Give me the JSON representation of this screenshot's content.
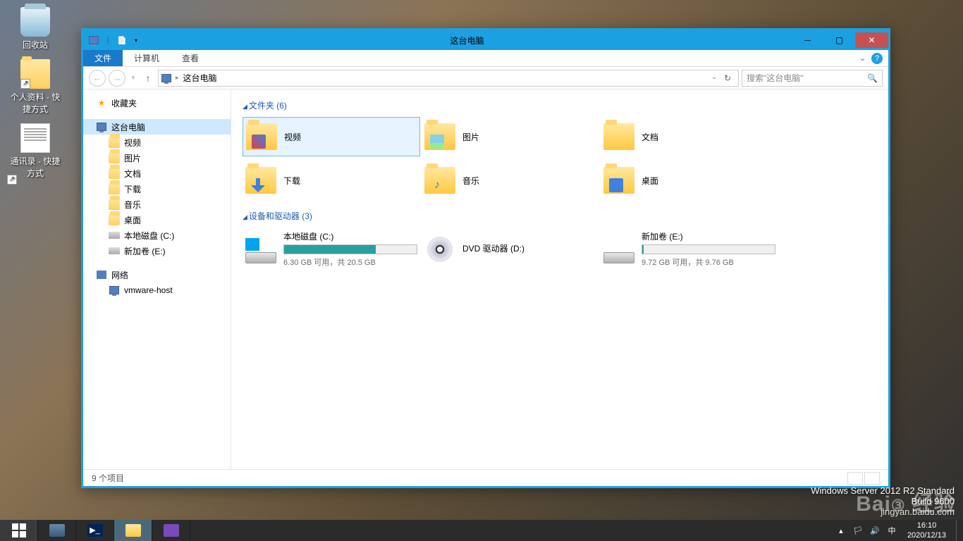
{
  "desktop": {
    "recycle": "回收站",
    "profile": "个人资料 - 快捷方式",
    "contacts": "通讯录 - 快捷方式"
  },
  "window": {
    "title": "这台电脑",
    "tabs": {
      "file": "文件",
      "computer": "计算机",
      "view": "查看"
    },
    "address": "这台电脑",
    "search_placeholder": "搜索\"这台电脑\"",
    "nav": {
      "favorites": "收藏夹",
      "thispc": "这台电脑",
      "items": [
        "视频",
        "图片",
        "文档",
        "下载",
        "音乐",
        "桌面"
      ],
      "drive_c": "本地磁盘 (C:)",
      "drive_e": "新加卷 (E:)",
      "network": "网络",
      "vmhost": "vmware-host"
    },
    "groups": {
      "folders_header": "文件夹 (6)",
      "devices_header": "设备和驱动器 (3)"
    },
    "folders": [
      {
        "label": "视频"
      },
      {
        "label": "图片"
      },
      {
        "label": "文档"
      },
      {
        "label": "下载"
      },
      {
        "label": "音乐"
      },
      {
        "label": "桌面"
      }
    ],
    "drives": {
      "c": {
        "name": "本地磁盘 (C:)",
        "stats": "6.30 GB 可用，共 20.5 GB",
        "pct": 69
      },
      "d": {
        "name": "DVD 驱动器 (D:)"
      },
      "e": {
        "name": "新加卷 (E:)",
        "stats": "9.72 GB 可用，共 9.76 GB",
        "pct": 1
      }
    },
    "status": "9 个项目"
  },
  "watermark": {
    "line1": "Windows Server 2012 R2 Standard",
    "line2": "Build 9600",
    "baidu": "jingyan.baidu.com"
  },
  "taskbar": {
    "time": "16:10",
    "date": "2020/12/13"
  }
}
